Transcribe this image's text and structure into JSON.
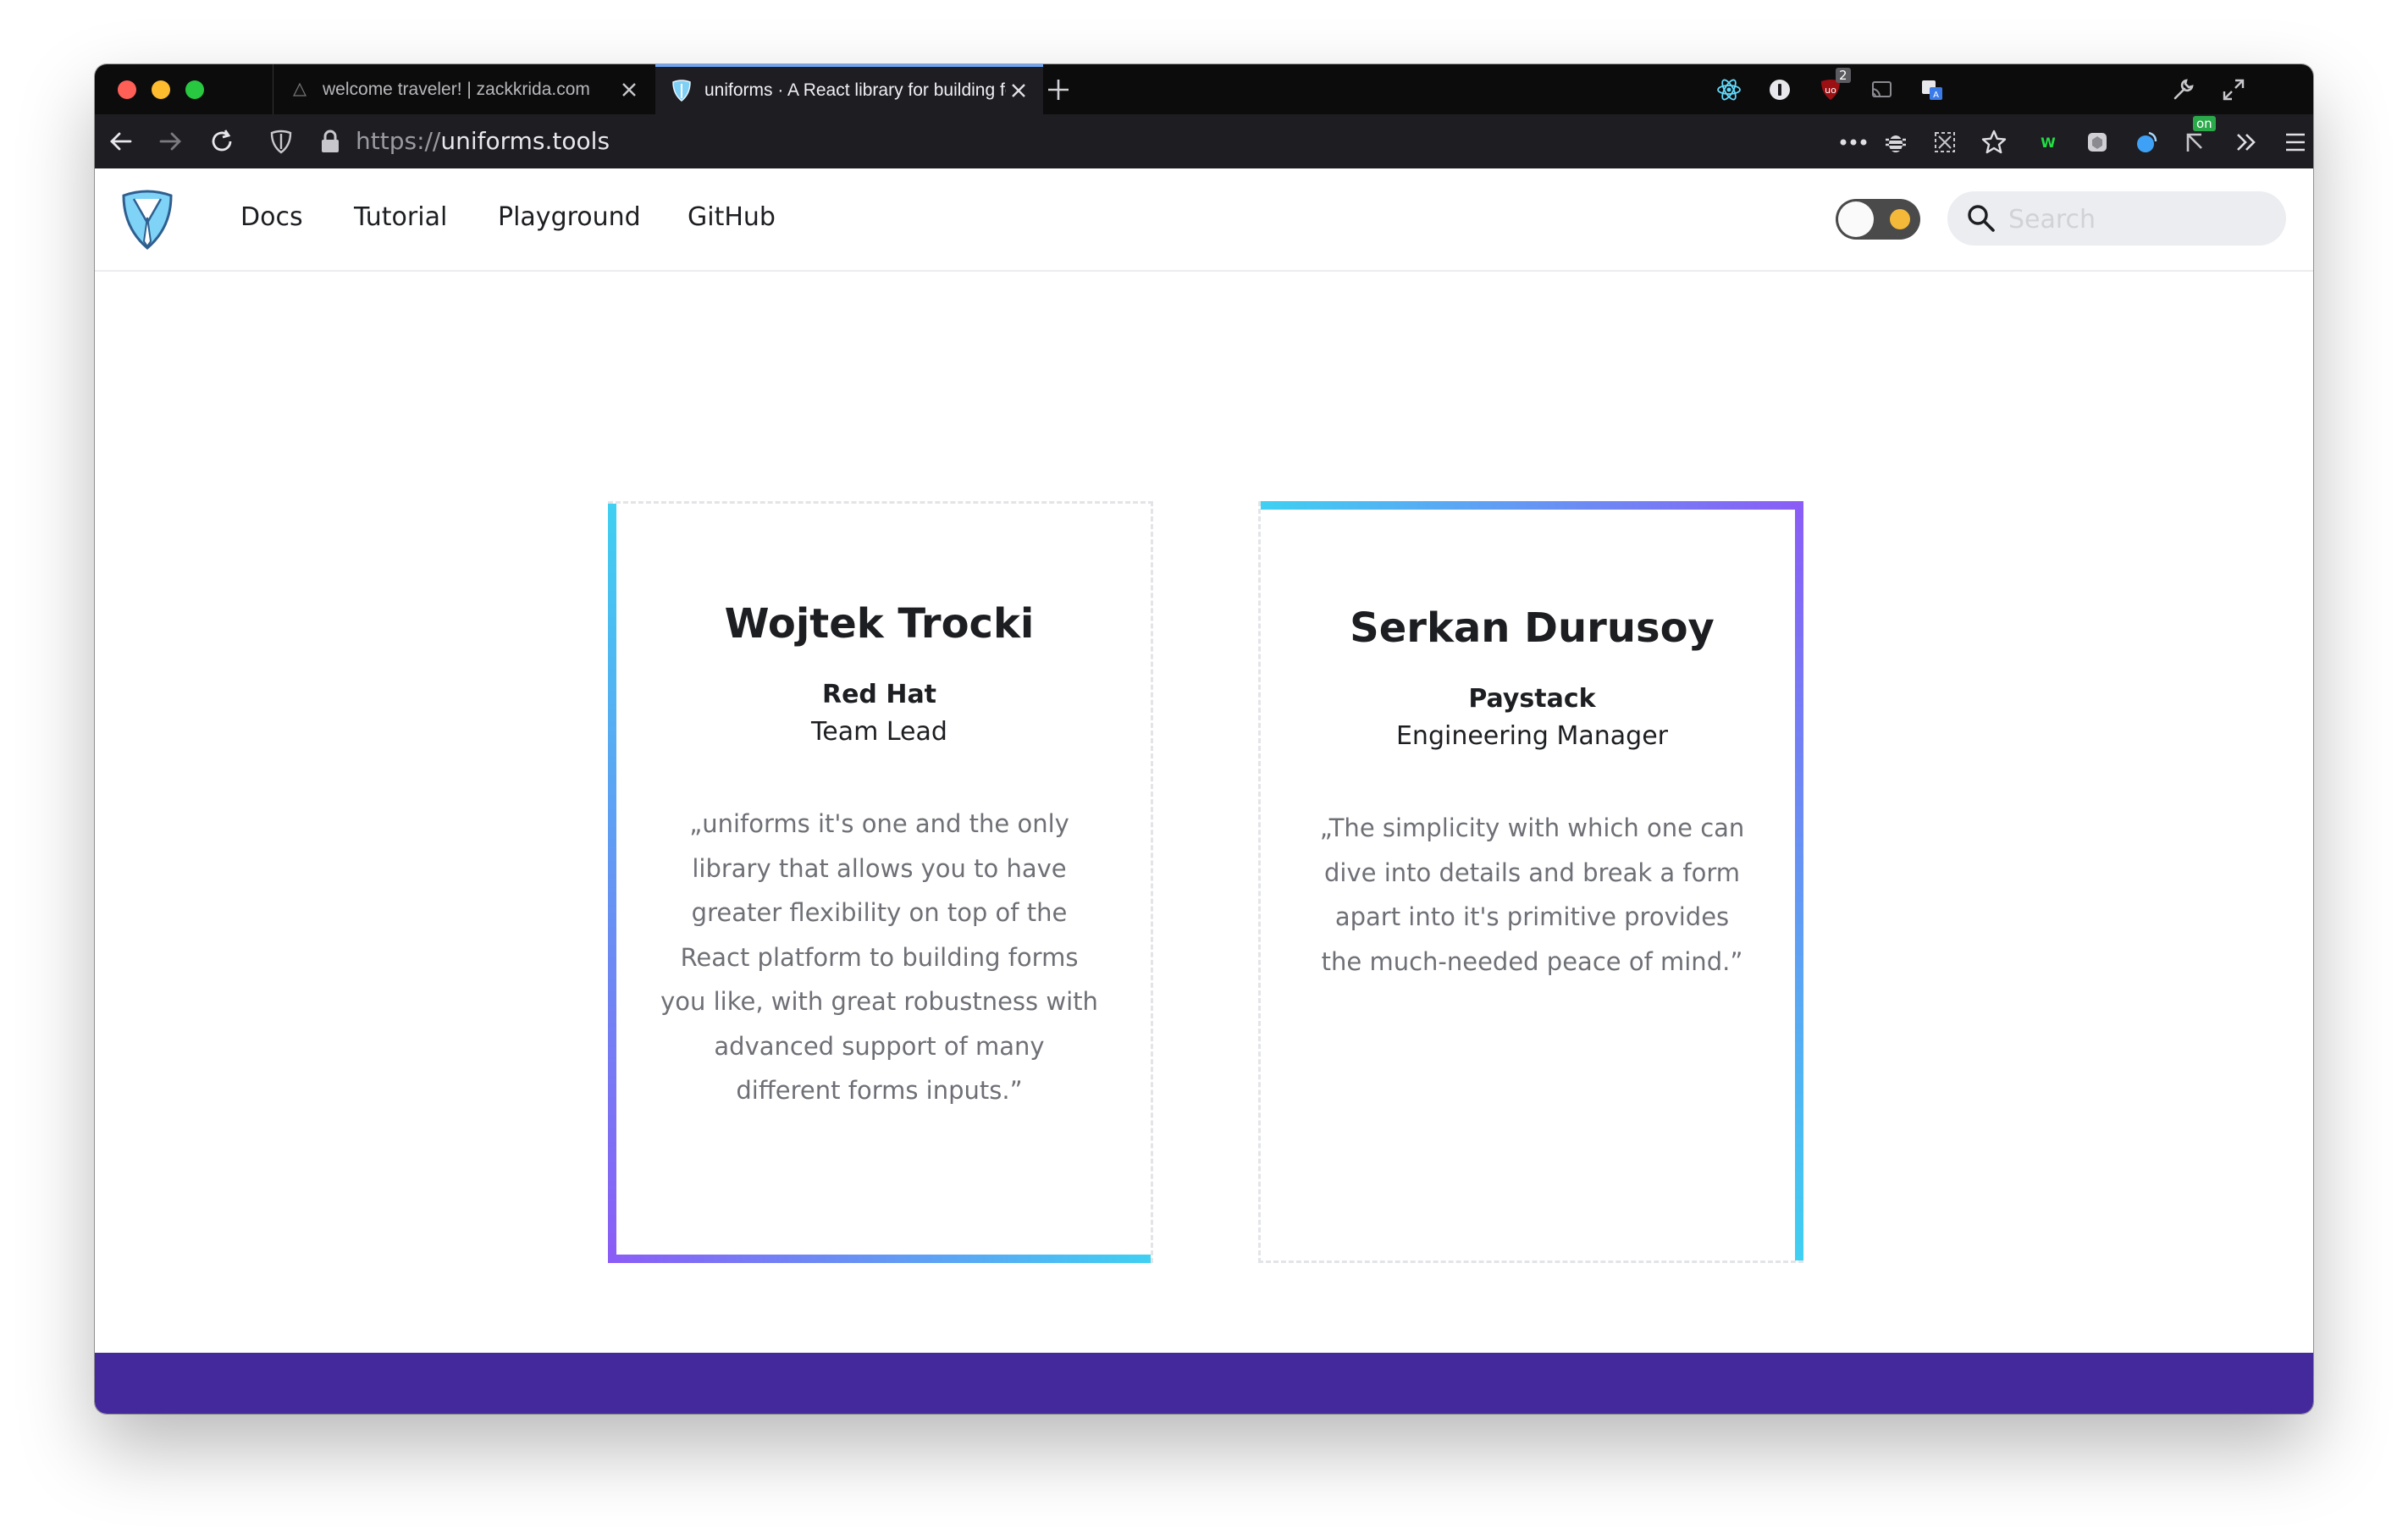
{
  "browser": {
    "tabs": [
      {
        "title": "welcome traveler! | zackkrida.com",
        "active": false
      },
      {
        "title": "uniforms · A React library for building forms from any schema",
        "active": true
      }
    ],
    "address": {
      "protocol": "https://",
      "host": "uniforms.tools"
    },
    "badges": {
      "ublock_count": "2",
      "toggle_ext": "on"
    },
    "icons": [
      "back-icon",
      "forward-icon",
      "reload-icon",
      "shield-icon",
      "lock-icon",
      "react-devtools-icon",
      "1password-icon",
      "ublock-icon",
      "cast-icon",
      "translate-icon",
      "wrench-icon",
      "expand-icon",
      "more-icon",
      "bug-icon",
      "screenshot-icon",
      "bookmark-star-icon",
      "wappalyzer-icon",
      "extension-icon",
      "droplet-icon",
      "toggle-extension-icon",
      "overflow-icon",
      "hamburger-menu-icon"
    ]
  },
  "site": {
    "nav": [
      {
        "label": "Docs"
      },
      {
        "label": "Tutorial"
      },
      {
        "label": "Playground"
      },
      {
        "label": "GitHub"
      }
    ],
    "search": {
      "placeholder": "Search",
      "value": ""
    },
    "theme_toggle": {
      "state": "light"
    },
    "footer_color": "#43299b"
  },
  "testimonials": [
    {
      "name": "Wojtek Trocki",
      "company": "Red Hat",
      "role": "Team Lead",
      "quote": "„uniforms it's one and the only library that allows you to have greater flexibility on top of the React platform to building forms you like, with great robustness with advanced support of many different forms inputs.”"
    },
    {
      "name": "Serkan Durusoy",
      "company": "Paystack",
      "role": "Engineering Manager",
      "quote": "„The simplicity with which one can dive into details and break a form apart into it's primitive provides the much-needed peace of mind.”"
    }
  ],
  "colors": {
    "gradient_start": "#3fd0f2",
    "gradient_end": "#8b5cf6",
    "tab_accent": "#6aa5ff"
  }
}
